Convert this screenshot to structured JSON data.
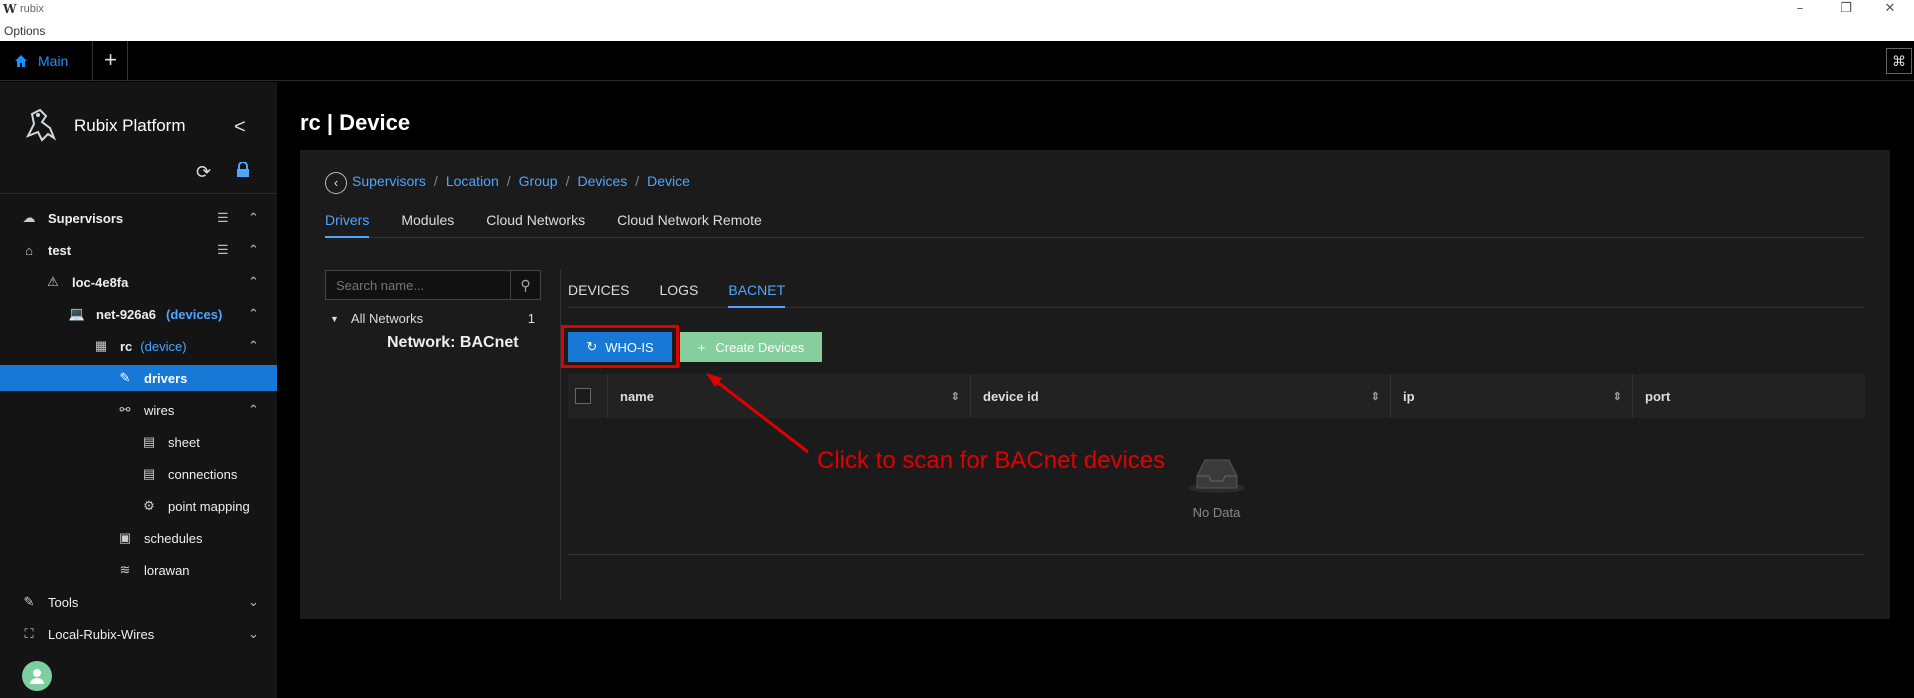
{
  "titlebar": {
    "logo": "W",
    "app_title": "rubix",
    "menu_options": "Options",
    "minimize": "–",
    "restore": "❐",
    "close": "✕"
  },
  "tabbar": {
    "main_tab": "Main",
    "add_tab": "+",
    "right_icon": "⌘"
  },
  "sidebar": {
    "brand": "Rubix Platform",
    "collapse": "<",
    "items": [
      {
        "label": "Supervisors",
        "icon": "cloud-icon"
      },
      {
        "label": "test",
        "icon": "home-icon"
      },
      {
        "label": "loc-4e8fa",
        "icon": "location-icon"
      },
      {
        "label": "net-926a6",
        "suffix": "(devices)",
        "icon": "laptop-icon"
      },
      {
        "label": "rc",
        "suffix": "(device)",
        "icon": "device-icon"
      },
      {
        "label": "drivers",
        "icon": "wrench-icon"
      },
      {
        "label": "wires",
        "icon": "wires-icon"
      },
      {
        "label": "sheet",
        "icon": "sheet-icon"
      },
      {
        "label": "connections",
        "icon": "connections-icon"
      },
      {
        "label": "point mapping",
        "icon": "point-mapping-icon"
      },
      {
        "label": "schedules",
        "icon": "schedule-icon"
      },
      {
        "label": "lorawan",
        "icon": "wifi-icon"
      },
      {
        "label": "Tools",
        "icon": "tools-icon"
      },
      {
        "label": "Local-Rubix-Wires",
        "icon": "network-icon"
      }
    ]
  },
  "main": {
    "title": "rc | Device",
    "breadcrumb": [
      "Supervisors",
      "Location",
      "Group",
      "Devices",
      "Device"
    ],
    "tabs": [
      "Drivers",
      "Modules",
      "Cloud Networks",
      "Cloud Network Remote"
    ],
    "search_placeholder": "Search name...",
    "networks": {
      "all_label": "All Networks",
      "count": "1",
      "network": "Network: BACnet"
    },
    "subtabs": [
      "DEVICES",
      "LOGS",
      "BACNET"
    ],
    "whois_label": "WHO-IS",
    "create_label": "Create Devices",
    "columns": [
      "name",
      "device id",
      "ip",
      "port"
    ],
    "empty_text": "No Data"
  },
  "annotation": "Click to scan for BACnet devices",
  "colors": {
    "accent": "#1778d6",
    "highlight": "#e00000",
    "create": "#86cf9d"
  }
}
